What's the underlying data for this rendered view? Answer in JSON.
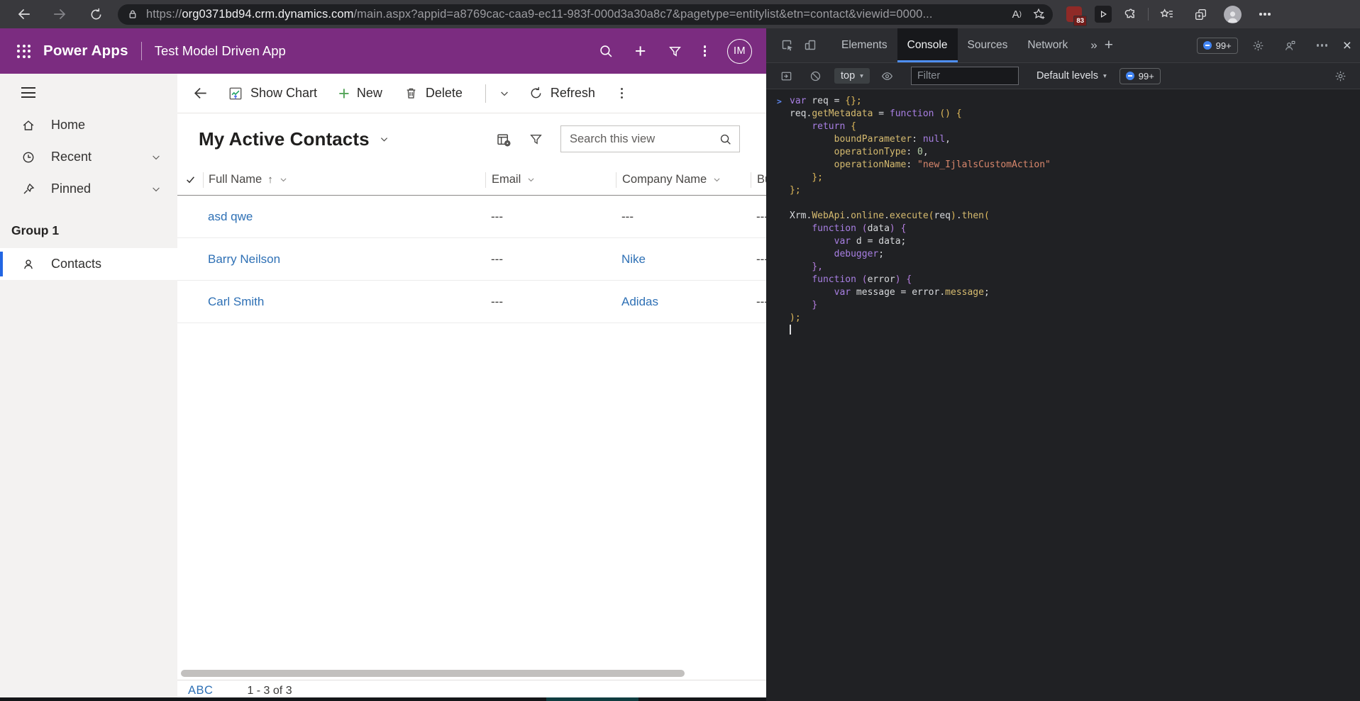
{
  "colors": {
    "brand_purple": "#7b2c80",
    "link_blue": "#2e70b5",
    "nav_indicator": "#2266e3",
    "devtools_accent": "#4e8ef0",
    "new_button_green": "#53a458"
  },
  "browser": {
    "url_scheme": "https://",
    "url_domain": "org0371bd94.crm.dynamics.com",
    "url_path": "/main.aspx?appid=a8769cac-caa9-ec11-983f-000d3a30a8c7&pagetype=entitylist&etn=contact&viewid=0000...",
    "read_aloud_label": "A",
    "extension_badge": "83"
  },
  "app_header": {
    "brand": "Power Apps",
    "app_name": "Test Model Driven App",
    "avatar_initials": "IM"
  },
  "sidebar": {
    "items": [
      {
        "label": "Home",
        "icon": "home-icon",
        "chevron": false,
        "selected": false
      },
      {
        "label": "Recent",
        "icon": "clock-icon",
        "chevron": true,
        "selected": false
      },
      {
        "label": "Pinned",
        "icon": "pin-icon",
        "chevron": true,
        "selected": false
      }
    ],
    "group_label": "Group 1",
    "group_items": [
      {
        "label": "Contacts",
        "icon": "person-icon",
        "chevron": false,
        "selected": true
      }
    ]
  },
  "command_bar": {
    "show_chart": "Show Chart",
    "new": "New",
    "delete": "Delete",
    "refresh": "Refresh"
  },
  "view": {
    "title": "My Active Contacts",
    "search_placeholder": "Search this view"
  },
  "grid": {
    "columns": [
      {
        "label": "Full Name",
        "sorted": true
      },
      {
        "label": "Email"
      },
      {
        "label": "Company Name"
      },
      {
        "label": "Bu"
      }
    ],
    "rows": [
      {
        "full_name": "asd qwe",
        "email": "---",
        "company": "---",
        "company_link": false,
        "business": "---"
      },
      {
        "full_name": "Barry Neilson",
        "email": "---",
        "company": "Nike",
        "company_link": true,
        "business": "---"
      },
      {
        "full_name": "Carl Smith",
        "email": "---",
        "company": "Adidas",
        "company_link": true,
        "business": "---"
      }
    ]
  },
  "footer": {
    "jump": "ABC",
    "range": "1 - 3 of 3"
  },
  "devtools": {
    "tabs": [
      {
        "label": "Elements"
      },
      {
        "label": "Console",
        "active": true
      },
      {
        "label": "Sources"
      },
      {
        "label": "Network"
      }
    ],
    "issues_badge": "99+",
    "toolbar": {
      "context": "top",
      "filter_placeholder": "Filter",
      "levels": "Default levels",
      "badge": "99+"
    },
    "console": {
      "lines": [
        {
          "prompt": true,
          "segs": [
            {
              "c": "kw",
              "t": "var"
            },
            {
              "c": "t",
              "t": " req = "
            },
            {
              "c": "br",
              "t": "{};"
            }
          ]
        },
        {
          "segs": [
            {
              "c": "t",
              "t": "req."
            },
            {
              "c": "prop",
              "t": "getMetadata"
            },
            {
              "c": "t",
              "t": " = "
            },
            {
              "c": "kw",
              "t": "function"
            },
            {
              "c": "t",
              "t": " "
            },
            {
              "c": "br",
              "t": "()"
            },
            {
              "c": "t",
              "t": " "
            },
            {
              "c": "br",
              "t": "{"
            }
          ]
        },
        {
          "segs": [
            {
              "c": "t",
              "t": "    "
            },
            {
              "c": "kw",
              "t": "return"
            },
            {
              "c": "t",
              "t": " "
            },
            {
              "c": "br",
              "t": "{"
            }
          ]
        },
        {
          "segs": [
            {
              "c": "t",
              "t": "        "
            },
            {
              "c": "prop",
              "t": "boundParameter"
            },
            {
              "c": "t",
              "t": ": "
            },
            {
              "c": "kw",
              "t": "null"
            },
            {
              "c": "t",
              "t": ","
            }
          ]
        },
        {
          "segs": [
            {
              "c": "t",
              "t": "        "
            },
            {
              "c": "prop",
              "t": "operationType"
            },
            {
              "c": "t",
              "t": ": "
            },
            {
              "c": "num",
              "t": "0"
            },
            {
              "c": "t",
              "t": ","
            }
          ]
        },
        {
          "segs": [
            {
              "c": "t",
              "t": "        "
            },
            {
              "c": "prop",
              "t": "operationName"
            },
            {
              "c": "t",
              "t": ": "
            },
            {
              "c": "str",
              "t": "\"new_IjlalsCustomAction\""
            }
          ]
        },
        {
          "segs": [
            {
              "c": "t",
              "t": "    "
            },
            {
              "c": "br",
              "t": "};"
            }
          ]
        },
        {
          "segs": [
            {
              "c": "br",
              "t": "};"
            }
          ]
        },
        {
          "segs": []
        },
        {
          "segs": [
            {
              "c": "t",
              "t": "Xrm."
            },
            {
              "c": "prop",
              "t": "WebApi"
            },
            {
              "c": "t",
              "t": "."
            },
            {
              "c": "prop",
              "t": "online"
            },
            {
              "c": "t",
              "t": "."
            },
            {
              "c": "prop",
              "t": "execute"
            },
            {
              "c": "br",
              "t": "("
            },
            {
              "c": "t",
              "t": "req"
            },
            {
              "c": "br",
              "t": ")"
            },
            {
              "c": "t",
              "t": "."
            },
            {
              "c": "prop",
              "t": "then"
            },
            {
              "c": "br",
              "t": "("
            }
          ]
        },
        {
          "segs": [
            {
              "c": "t",
              "t": "    "
            },
            {
              "c": "kw",
              "t": "function"
            },
            {
              "c": "t",
              "t": " "
            },
            {
              "c": "br2",
              "t": "("
            },
            {
              "c": "t",
              "t": "data"
            },
            {
              "c": "br2",
              "t": ")"
            },
            {
              "c": "t",
              "t": " "
            },
            {
              "c": "br2",
              "t": "{"
            }
          ]
        },
        {
          "segs": [
            {
              "c": "t",
              "t": "        "
            },
            {
              "c": "kw",
              "t": "var"
            },
            {
              "c": "t",
              "t": " d = data;"
            }
          ]
        },
        {
          "segs": [
            {
              "c": "t",
              "t": "        "
            },
            {
              "c": "kw",
              "t": "debugger"
            },
            {
              "c": "t",
              "t": ";"
            }
          ]
        },
        {
          "segs": [
            {
              "c": "t",
              "t": "    "
            },
            {
              "c": "br2",
              "t": "},"
            }
          ]
        },
        {
          "segs": [
            {
              "c": "t",
              "t": "    "
            },
            {
              "c": "kw",
              "t": "function"
            },
            {
              "c": "t",
              "t": " "
            },
            {
              "c": "br2",
              "t": "("
            },
            {
              "c": "t",
              "t": "error"
            },
            {
              "c": "br2",
              "t": ")"
            },
            {
              "c": "t",
              "t": " "
            },
            {
              "c": "br2",
              "t": "{"
            }
          ]
        },
        {
          "segs": [
            {
              "c": "t",
              "t": "        "
            },
            {
              "c": "kw",
              "t": "var"
            },
            {
              "c": "t",
              "t": " message = error."
            },
            {
              "c": "prop",
              "t": "message"
            },
            {
              "c": "t",
              "t": ";"
            }
          ]
        },
        {
          "segs": [
            {
              "c": "t",
              "t": "    "
            },
            {
              "c": "br2",
              "t": "}"
            }
          ]
        },
        {
          "segs": [
            {
              "c": "br",
              "t": ");"
            }
          ]
        },
        {
          "caret": true,
          "segs": []
        }
      ]
    }
  }
}
